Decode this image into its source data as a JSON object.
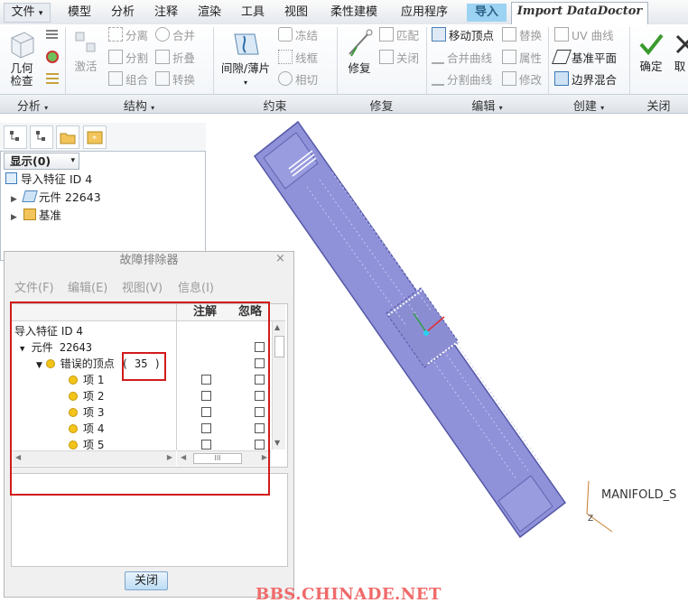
{
  "menu": {
    "file": "文件",
    "tabs": [
      "模型",
      "分析",
      "注释",
      "渲染",
      "工具",
      "视图",
      "柔性建模",
      "应用程序",
      "导入",
      "Import DataDoctor"
    ]
  },
  "ribbon": {
    "analysis": {
      "big_button": "几何\n检查",
      "group": "分析"
    },
    "structure": {
      "big_button": "激活",
      "items": [
        "分离",
        "合并",
        "分割",
        "折叠",
        "组合",
        "转换"
      ],
      "group": "结构"
    },
    "constraint": {
      "big_button": "间隙/薄片",
      "items": [
        "冻结",
        "线框",
        "相切"
      ],
      "group": "约束"
    },
    "repair": {
      "big_button": "修复",
      "items": [
        "匹配",
        "关闭"
      ],
      "group": "修复"
    },
    "edit": {
      "items": [
        "移动顶点",
        "替换",
        "合并曲线",
        "属性",
        "分割曲线",
        "修改"
      ],
      "group": "编辑"
    },
    "create": {
      "items": [
        "UV 曲线",
        "基准平面",
        "边界混合"
      ],
      "group": "创建"
    },
    "close": {
      "confirm": "确定",
      "cancel": "取",
      "group": "关闭"
    }
  },
  "left_panel": {
    "show_dropdown": "显示(0)",
    "tree": [
      {
        "label": "导入特征 ID 4"
      },
      {
        "label": "元件 22643"
      },
      {
        "label": "基准"
      }
    ]
  },
  "dialog": {
    "title": "故障排除器",
    "close_glyph": "×",
    "menu": [
      "文件(F)",
      "编辑(E)",
      "视图(V)",
      "信息(I)"
    ],
    "columns": [
      "注解",
      "忽略"
    ],
    "rows": [
      {
        "label": "导入特征  ID 4",
        "checked_note": false,
        "checked_ignore": false
      },
      {
        "label": "元件  22643"
      },
      {
        "label": "错误的顶点",
        "count": "( 35 )"
      },
      {
        "label": "项 1"
      },
      {
        "label": "项 2"
      },
      {
        "label": "项 3"
      },
      {
        "label": "项 4"
      },
      {
        "label": "项 5"
      }
    ],
    "scroll_glyph": "III",
    "close_button": "关闭"
  },
  "viewport": {
    "part_label": "MANIFOLD_S",
    "part_color": "#8f91d9",
    "axis_label": "Z"
  },
  "watermark": "BBS.CHINADE.NET",
  "colors": {
    "active_tab": "#9dd3f2",
    "highlight_box": "#d21b1b",
    "status_dot": "#f3c41a"
  }
}
